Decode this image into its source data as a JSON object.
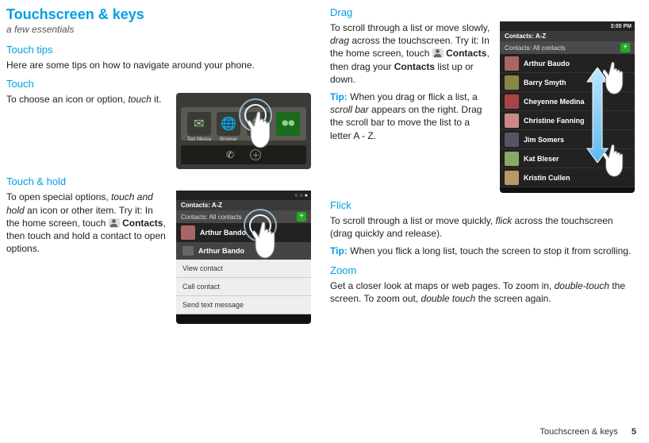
{
  "title": "Touchscreen & keys",
  "subtitle": "a few essentials",
  "touch_tips": {
    "heading": "Touch tips",
    "intro": "Here are some tips on how to navigate around your phone."
  },
  "touch": {
    "heading": "Touch",
    "body_pre": "To choose an icon or option, ",
    "body_em": "touch",
    "body_post": " it.",
    "dock": {
      "label1": "Text Messa",
      "label2": "Browser"
    }
  },
  "touch_hold": {
    "heading": "Touch & hold",
    "body_pre": "To open special options, ",
    "body_em": "touch and hold",
    "body_mid": " an icon or other item. Try it: In the home screen, touch ",
    "contacts_label": "Contacts",
    "body_post": ", then touch and hold a contact to open options.",
    "screen": {
      "hdr1": "Contacts: A-Z",
      "hdr2": "Contacts: All contacts",
      "row_name": "Arthur Bando",
      "menu_title": "Arthur Bando",
      "menu_items": [
        "View contact",
        "Call contact",
        "Send text message"
      ]
    }
  },
  "drag": {
    "heading": "Drag",
    "body_pre": "To scroll through a list or move slowly, ",
    "body_em": "drag",
    "body_mid": " across the touchscreen. Try it: In the home screen, touch ",
    "contacts_label": "Contacts",
    "body_mid2": ", then drag your ",
    "contacts_label2": "Contacts",
    "body_post": " list up or down.",
    "tip_label": "Tip:",
    "tip_pre": " When you drag or flick a list, a ",
    "tip_em": "scroll bar",
    "tip_post": " appears on the right. Drag the scroll bar to move the list to a letter A - Z.",
    "screen": {
      "time": "3:00 PM",
      "hdr1": "Contacts: A-Z",
      "hdr2": "Contacts: All contacts",
      "rows": [
        "Arthur Baudo",
        "Barry Smyth",
        "Cheyenne Medina",
        "Christine Fanning",
        "Jim Somers",
        "Kat Bleser",
        "Kristin Cullen"
      ]
    }
  },
  "flick": {
    "heading": "Flick",
    "body_pre": "To scroll through a list or move quickly, ",
    "body_em": "flick",
    "body_post": " across the touchscreen (drag quickly and release).",
    "tip_label": "Tip:",
    "tip_body": " When you flick a long list, touch the screen to stop it from scrolling."
  },
  "zoom": {
    "heading": "Zoom",
    "body_pre": "Get a closer look at maps or web pages. To zoom in, ",
    "body_em1": "double-touch",
    "body_mid": " the screen. To zoom out, ",
    "body_em2": "double touch",
    "body_post": " the screen again."
  },
  "footer": {
    "section": "Touchscreen & keys",
    "page": "5"
  }
}
